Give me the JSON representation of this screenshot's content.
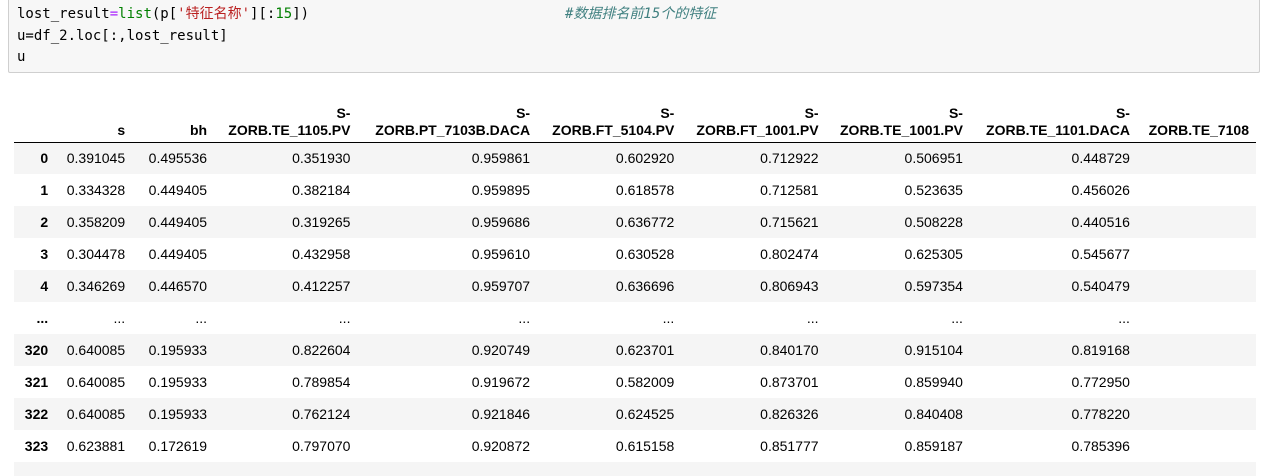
{
  "code": {
    "line1_var": "lost_result",
    "line1_eq": "=",
    "line1_fn": "list",
    "line1_open": "(p[",
    "line1_str": "'特征名称'",
    "line1_mid": "][:",
    "line1_num": "15",
    "line1_close": "])",
    "comment": "#数据排名前15个的特征",
    "line2": "u=df_2.loc[:,lost_result]",
    "line3": "u"
  },
  "table": {
    "columns": [
      {
        "top": "",
        "bottom": ""
      },
      {
        "top": "",
        "bottom": "s"
      },
      {
        "top": "",
        "bottom": "bh"
      },
      {
        "top": "S-",
        "bottom": "ZORB.TE_1105.PV"
      },
      {
        "top": "S-",
        "bottom": "ZORB.PT_7103B.DACA"
      },
      {
        "top": "S-",
        "bottom": "ZORB.FT_5104.PV"
      },
      {
        "top": "S-",
        "bottom": "ZORB.FT_1001.PV"
      },
      {
        "top": "S-",
        "bottom": "ZORB.TE_1001.PV"
      },
      {
        "top": "S-",
        "bottom": "ZORB.TE_1101.DACA"
      },
      {
        "top": "",
        "bottom": "ZORB.TE_7108"
      }
    ],
    "rows": [
      [
        "0",
        "0.391045",
        "0.495536",
        "0.351930",
        "0.959861",
        "0.602920",
        "0.712922",
        "0.506951",
        "0.448729",
        ""
      ],
      [
        "1",
        "0.334328",
        "0.449405",
        "0.382184",
        "0.959895",
        "0.618578",
        "0.712581",
        "0.523635",
        "0.456026",
        ""
      ],
      [
        "2",
        "0.358209",
        "0.449405",
        "0.319265",
        "0.959686",
        "0.636772",
        "0.715621",
        "0.508228",
        "0.440516",
        ""
      ],
      [
        "3",
        "0.304478",
        "0.449405",
        "0.432958",
        "0.959610",
        "0.630528",
        "0.802474",
        "0.625305",
        "0.545677",
        ""
      ],
      [
        "4",
        "0.346269",
        "0.446570",
        "0.412257",
        "0.959707",
        "0.636696",
        "0.806943",
        "0.597354",
        "0.540479",
        ""
      ],
      [
        "...",
        "...",
        "...",
        "...",
        "...",
        "...",
        "...",
        "...",
        "...",
        ""
      ],
      [
        "320",
        "0.640085",
        "0.195933",
        "0.822604",
        "0.920749",
        "0.623701",
        "0.840170",
        "0.915104",
        "0.819168",
        ""
      ],
      [
        "321",
        "0.640085",
        "0.195933",
        "0.789854",
        "0.919672",
        "0.582009",
        "0.873701",
        "0.859940",
        "0.772950",
        ""
      ],
      [
        "322",
        "0.640085",
        "0.195933",
        "0.762124",
        "0.921846",
        "0.624525",
        "0.826326",
        "0.840408",
        "0.778220",
        ""
      ],
      [
        "323",
        "0.623881",
        "0.172619",
        "0.797070",
        "0.920872",
        "0.615158",
        "0.851777",
        "0.859187",
        "0.785396",
        ""
      ],
      [
        "",
        "",
        "",
        "",
        "",
        "",
        "",
        "",
        "",
        ""
      ]
    ]
  }
}
